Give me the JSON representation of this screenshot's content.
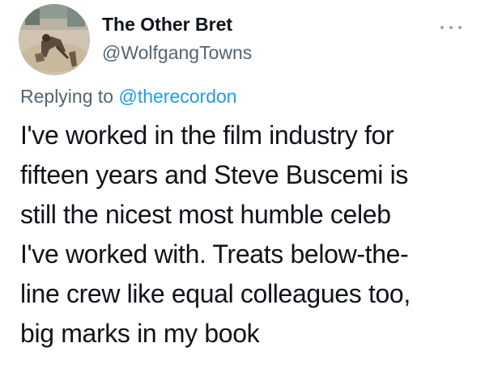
{
  "user": {
    "display_name": "The Other Bret",
    "handle": "@WolfgangTowns"
  },
  "reply": {
    "prefix": "Replying to",
    "mention": "@therecordon"
  },
  "tweet": {
    "lines": [
      "I've worked in the film industry for",
      "fifteen years and Steve Buscemi is",
      "still the nicest most humble celeb",
      "I've worked with. Treats below-the-",
      "line crew like equal colleagues too,",
      "big marks in my book"
    ]
  },
  "icons": {
    "more": "more-options-icon"
  },
  "colors": {
    "text_primary": "#0f1419",
    "text_secondary": "#536471",
    "mention": "#1d9bf0",
    "background": "#ffffff"
  }
}
